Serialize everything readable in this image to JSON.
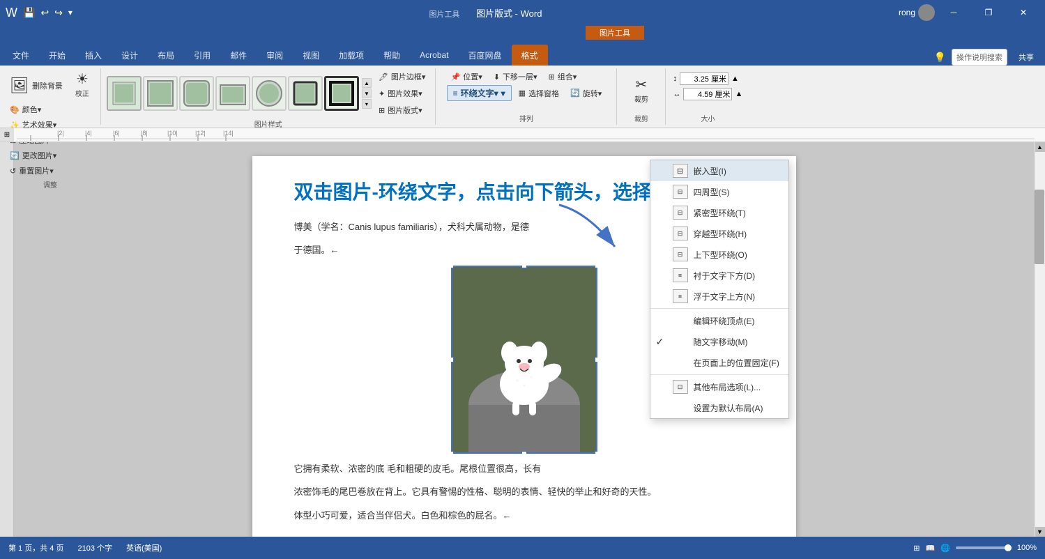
{
  "titlebar": {
    "title": "图片版式 - Word",
    "tools_label": "图片工具",
    "user": "rong",
    "save_icon": "💾",
    "undo_icon": "↩",
    "redo_icon": "↪",
    "customize_icon": "▾",
    "minimize": "─",
    "restore": "❐",
    "close": "✕"
  },
  "tabs": {
    "items": [
      "文件",
      "开始",
      "插入",
      "设计",
      "布局",
      "引用",
      "邮件",
      "审阅",
      "视图",
      "加载项",
      "帮助",
      "Acrobat",
      "百度网盘"
    ],
    "active": "格式",
    "tools_tab": "格式",
    "light_icon": "💡",
    "search_placeholder": "操作说明搜索",
    "share": "共享"
  },
  "ribbon": {
    "groups": {
      "adjust": {
        "label": "调整",
        "remove_bg": "删除背景",
        "correct": "校正",
        "color": "颜色▾",
        "art_effect": "艺术效果▾",
        "compress": "压缩图片",
        "change_pic": "更改图片▾",
        "reset_pic": "重置图片▾"
      },
      "pic_styles": {
        "label": "图片样式",
        "border": "图片边框▾",
        "effect": "图片效果▾",
        "format": "图片版式▾"
      },
      "arrange": {
        "label": "排列",
        "position": "位置▾",
        "wrap_text": "环绕文字▾",
        "move_back": "下移一层▾",
        "group": "组合▾",
        "select_pane": "选择窗格",
        "rotate": "旋转▾"
      },
      "crop": {
        "label": "裁剪",
        "crop_btn": "裁剪"
      },
      "size": {
        "label": "大小",
        "height_label": "",
        "width_label": "",
        "height_value": "3.25 厘米",
        "width_value": "4.59 厘米"
      }
    }
  },
  "wrap_menu": {
    "items": [
      {
        "id": "embed",
        "label": "嵌入型(I)",
        "icon": "⊞",
        "check": "",
        "shortcut": ""
      },
      {
        "id": "square",
        "label": "四周型(S)",
        "icon": "⊟",
        "check": "",
        "shortcut": ""
      },
      {
        "id": "tight",
        "label": "紧密型环绕(T)",
        "icon": "⊟",
        "check": "",
        "shortcut": ""
      },
      {
        "id": "through",
        "label": "穿越型环绕(H)",
        "icon": "⊟",
        "check": "",
        "shortcut": ""
      },
      {
        "id": "topbottom",
        "label": "上下型环绕(O)",
        "icon": "⊟",
        "check": "",
        "shortcut": ""
      },
      {
        "id": "behind",
        "label": "衬于文字下方(D)",
        "icon": "⊟",
        "check": "",
        "shortcut": ""
      },
      {
        "id": "front",
        "label": "浮于文字上方(N)",
        "icon": "⊟",
        "check": "",
        "shortcut": ""
      },
      {
        "id": "divider1",
        "label": "",
        "type": "divider"
      },
      {
        "id": "editpoints",
        "label": "编辑环绕顶点(E)",
        "icon": "",
        "check": "",
        "shortcut": ""
      },
      {
        "id": "movetext",
        "label": "随文字移动(M)",
        "icon": "",
        "check": "✓",
        "shortcut": ""
      },
      {
        "id": "fixpos",
        "label": "在页面上的位置固定(F)",
        "icon": "",
        "check": "",
        "shortcut": ""
      },
      {
        "id": "divider2",
        "label": "",
        "type": "divider"
      },
      {
        "id": "moreoptions",
        "label": "其他布局选项(L)...",
        "icon": "⊡",
        "check": "",
        "shortcut": ""
      },
      {
        "id": "setdefault",
        "label": "设置为默认布局(A)",
        "icon": "",
        "check": "",
        "shortcut": ""
      }
    ]
  },
  "document": {
    "instruction": "双击图片-环绕文字，点击向下箭头，选择图片的版式",
    "para1": "博美（学名：Canis lupus familiaris），犬科犬属动物，是德",
    "para2": "于德国。←",
    "para3": "它拥有柔软、浓密的底              毛和粗硬的皮毛。尾根位置很高，长有",
    "para4": "浓密饰毛的尾巴卷放在背上。它具有警惕的性格、聪明的表情、轻快的举止和好奇的天性。",
    "para5": "体型小巧可爱，适合当伴侣犬。白色和棕色的屁名。←"
  },
  "statusbar": {
    "pages": "第 1 页，共 4 页",
    "words": "2103 个字",
    "language": "英语(美国)",
    "zoom": "100%"
  }
}
